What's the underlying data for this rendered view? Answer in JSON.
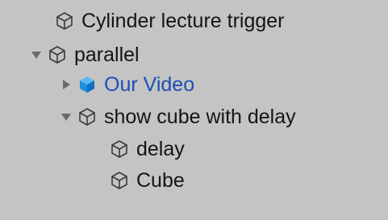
{
  "panel": "hierarchy",
  "colors": {
    "background": "#c4c4c4",
    "text": "#141414",
    "prefab_text": "#1a4fb5",
    "prefab_icon": "#1d8fe3",
    "icon_outline": "#3a3a3a",
    "foldout_arrow": "#6a6a6a"
  },
  "items": [
    {
      "label": "Cylinder lecture trigger",
      "foldout": "none",
      "icon": "gameobject-icon",
      "depth": 1
    },
    {
      "label": "parallel",
      "foldout": "expanded",
      "icon": "gameobject-icon",
      "depth": 0
    },
    {
      "label": "Our Video",
      "foldout": "collapsed",
      "icon": "prefab-icon",
      "depth": 1
    },
    {
      "label": "show cube with delay",
      "foldout": "expanded",
      "icon": "gameobject-icon",
      "depth": 1
    },
    {
      "label": "delay",
      "foldout": "none",
      "icon": "gameobject-icon",
      "depth": 2
    },
    {
      "label": "Cube",
      "foldout": "none",
      "icon": "gameobject-icon",
      "depth": 2
    }
  ]
}
